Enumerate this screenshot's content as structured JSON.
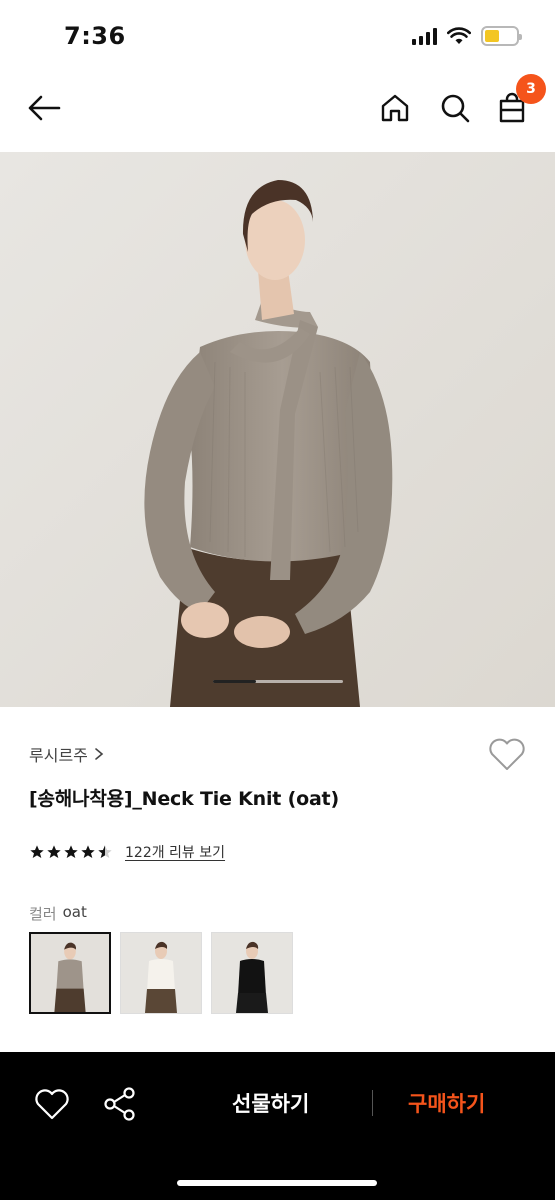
{
  "status_bar": {
    "time": "7:36"
  },
  "header": {
    "icons": [
      "back-arrow-icon",
      "home-icon",
      "search-icon",
      "shopping-bag-icon"
    ],
    "cart_count": "3"
  },
  "product": {
    "carousel_progress": 0.33,
    "brand": "루시르주",
    "title": "[송해나착용]_Neck Tie Knit (oat)",
    "rating": 4.5,
    "review_link": "122개 리뷰 보기",
    "color_label": "컬러",
    "color_value": "oat",
    "swatches": [
      "oat",
      "ivory",
      "black"
    ]
  },
  "bottom_bar": {
    "gift_label": "선물하기",
    "buy_label": "구매하기"
  },
  "colors": {
    "accent": "#f5541b",
    "badge": "#f5541b",
    "bottom_bar_bg": "#000000"
  }
}
